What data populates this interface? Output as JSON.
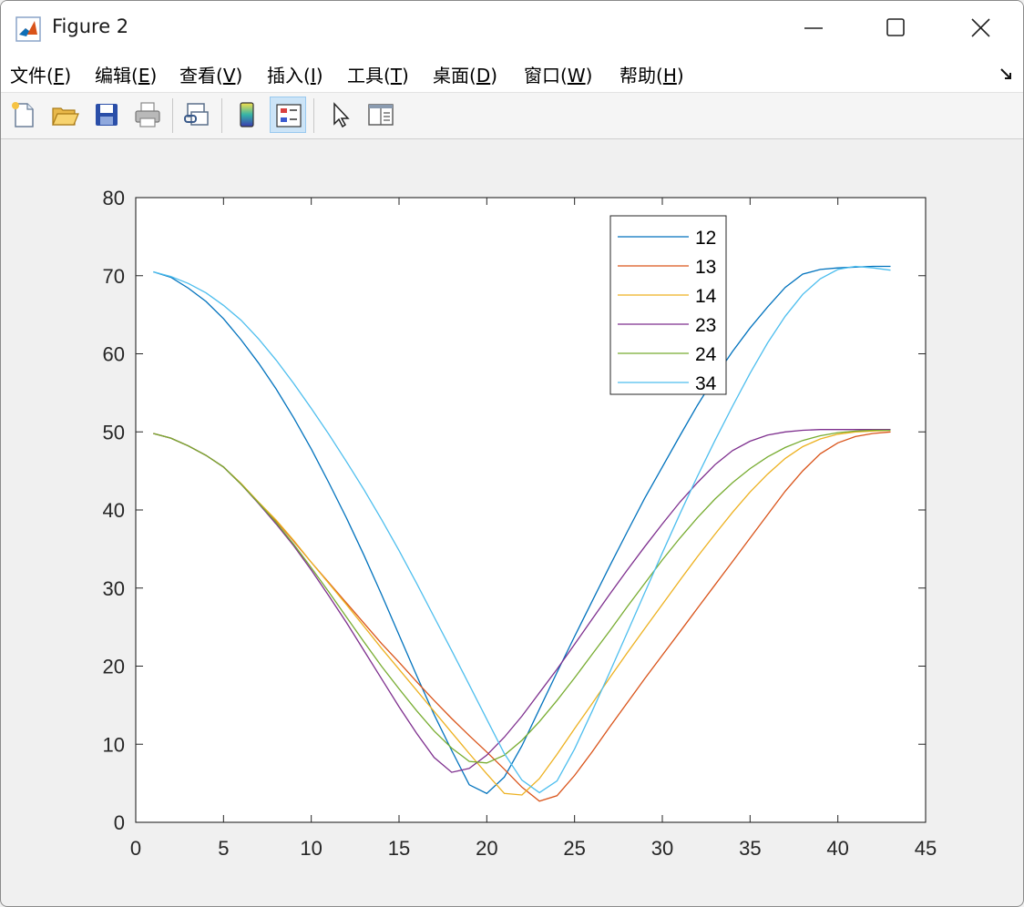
{
  "window": {
    "title": "Figure 2",
    "app_icon": "matlab-icon"
  },
  "menu": [
    {
      "label": "文件(",
      "key": "F",
      "end": ")"
    },
    {
      "label": "编辑(",
      "key": "E",
      "end": ")"
    },
    {
      "label": "查看(",
      "key": "V",
      "end": ")"
    },
    {
      "label": "插入(",
      "key": "I",
      "end": ")"
    },
    {
      "label": "工具(",
      "key": "T",
      "end": ")"
    },
    {
      "label": "桌面(",
      "key": "D",
      "end": ")"
    },
    {
      "label": "窗口(",
      "key": "W",
      "end": ")"
    },
    {
      "label": "帮助(",
      "key": "H",
      "end": ")"
    }
  ],
  "toolbar": [
    {
      "icon": "new-figure-icon"
    },
    {
      "icon": "open-file-icon"
    },
    {
      "icon": "save-icon"
    },
    {
      "icon": "print-icon"
    },
    {
      "icon": "link-plot-icon"
    },
    {
      "icon": "colorbar-icon"
    },
    {
      "icon": "legend-icon",
      "active": true
    },
    {
      "icon": "pointer-icon"
    },
    {
      "icon": "property-inspector-icon"
    }
  ],
  "chart_data": {
    "type": "line",
    "xlim": [
      0,
      45
    ],
    "ylim": [
      0,
      80
    ],
    "xticks": [
      0,
      5,
      10,
      15,
      20,
      25,
      30,
      35,
      40,
      45
    ],
    "yticks": [
      0,
      10,
      20,
      30,
      40,
      50,
      60,
      70,
      80
    ],
    "legend_position": "top-right",
    "grid": false,
    "series": [
      {
        "name": "12",
        "color": "#0072BD",
        "x": [
          1,
          2,
          3,
          4,
          5,
          6,
          7,
          8,
          9,
          10,
          11,
          12,
          13,
          14,
          15,
          16,
          17,
          18,
          19,
          20,
          21,
          22,
          23,
          24,
          25,
          26,
          27,
          28,
          29,
          30,
          31,
          32,
          33,
          34,
          35,
          36,
          37,
          38,
          39,
          40,
          41,
          42,
          43
        ],
        "y": [
          70.5,
          69.8,
          68.4,
          66.7,
          64.5,
          61.8,
          58.8,
          55.5,
          51.8,
          47.8,
          43.5,
          39.0,
          34.2,
          29.2,
          24.0,
          18.8,
          13.8,
          9.2,
          4.8,
          3.7,
          5.8,
          9.8,
          14.5,
          19.2,
          23.8,
          28.3,
          32.8,
          37.2,
          41.5,
          45.5,
          49.5,
          53.4,
          57.0,
          60.3,
          63.3,
          66.0,
          68.5,
          70.2,
          70.8,
          71.0,
          71.1,
          71.2,
          71.2
        ]
      },
      {
        "name": "13",
        "color": "#D95319",
        "x": [
          1,
          2,
          3,
          4,
          5,
          6,
          7,
          8,
          9,
          10,
          11,
          12,
          13,
          14,
          15,
          16,
          17,
          18,
          19,
          20,
          21,
          22,
          23,
          24,
          25,
          26,
          27,
          28,
          29,
          30,
          31,
          32,
          33,
          34,
          35,
          36,
          37,
          38,
          39,
          40,
          41,
          42,
          43
        ],
        "y": [
          49.8,
          49.2,
          48.2,
          47.0,
          45.5,
          43.3,
          40.9,
          38.6,
          36.0,
          33.3,
          30.7,
          28.1,
          25.5,
          22.9,
          20.5,
          18.0,
          15.6,
          13.3,
          11.1,
          9.0,
          6.8,
          4.5,
          2.7,
          3.4,
          6.0,
          9.0,
          12.2,
          15.3,
          18.4,
          21.4,
          24.4,
          27.4,
          30.4,
          33.4,
          36.4,
          39.4,
          42.4,
          45.0,
          47.2,
          48.6,
          49.4,
          49.8,
          50.0
        ]
      },
      {
        "name": "14",
        "color": "#EDB120",
        "x": [
          1,
          2,
          3,
          4,
          5,
          6,
          7,
          8,
          9,
          10,
          11,
          12,
          13,
          14,
          15,
          16,
          17,
          18,
          19,
          20,
          21,
          22,
          23,
          24,
          25,
          26,
          27,
          28,
          29,
          30,
          31,
          32,
          33,
          34,
          35,
          36,
          37,
          38,
          39,
          40,
          41,
          42,
          43
        ],
        "y": [
          49.8,
          49.2,
          48.2,
          47.0,
          45.5,
          43.4,
          41.0,
          38.7,
          36.1,
          33.3,
          30.6,
          27.9,
          25.1,
          22.3,
          19.6,
          16.9,
          14.2,
          11.5,
          8.8,
          6.2,
          3.7,
          3.5,
          5.6,
          8.7,
          12.0,
          15.2,
          18.5,
          21.7,
          24.8,
          27.9,
          31.0,
          34.0,
          36.9,
          39.7,
          42.3,
          44.6,
          46.6,
          48.1,
          49.1,
          49.7,
          50.0,
          50.1,
          50.2
        ]
      },
      {
        "name": "23",
        "color": "#7E2F8E",
        "x": [
          1,
          2,
          3,
          4,
          5,
          6,
          7,
          8,
          9,
          10,
          11,
          12,
          13,
          14,
          15,
          16,
          17,
          18,
          19,
          20,
          21,
          22,
          23,
          24,
          25,
          26,
          27,
          28,
          29,
          30,
          31,
          32,
          33,
          34,
          35,
          36,
          37,
          38,
          39,
          40,
          41,
          42,
          43
        ],
        "y": [
          49.8,
          49.2,
          48.2,
          47.0,
          45.5,
          43.3,
          40.8,
          38.2,
          35.4,
          32.3,
          29.0,
          25.6,
          22.0,
          18.4,
          14.8,
          11.4,
          8.3,
          6.4,
          6.9,
          8.6,
          10.9,
          13.6,
          16.6,
          19.6,
          22.8,
          26.0,
          29.2,
          32.3,
          35.3,
          38.2,
          41.0,
          43.5,
          45.8,
          47.6,
          48.8,
          49.6,
          50.0,
          50.2,
          50.3,
          50.3,
          50.3,
          50.3,
          50.3
        ]
      },
      {
        "name": "24",
        "color": "#77AC30",
        "x": [
          1,
          2,
          3,
          4,
          5,
          6,
          7,
          8,
          9,
          10,
          11,
          12,
          13,
          14,
          15,
          16,
          17,
          18,
          19,
          20,
          21,
          22,
          23,
          24,
          25,
          26,
          27,
          28,
          29,
          30,
          31,
          32,
          33,
          34,
          35,
          36,
          37,
          38,
          39,
          40,
          41,
          42,
          43
        ],
        "y": [
          49.8,
          49.2,
          48.2,
          47.0,
          45.5,
          43.3,
          40.9,
          38.4,
          35.6,
          32.6,
          29.5,
          26.3,
          23.1,
          20.0,
          17.1,
          14.3,
          11.7,
          9.5,
          7.8,
          7.6,
          8.6,
          10.5,
          12.9,
          15.6,
          18.5,
          21.5,
          24.5,
          27.6,
          30.6,
          33.6,
          36.4,
          39.0,
          41.4,
          43.5,
          45.3,
          46.8,
          48.0,
          48.9,
          49.5,
          49.9,
          50.1,
          50.2,
          50.2
        ]
      },
      {
        "name": "34",
        "color": "#4DBEEE",
        "x": [
          1,
          2,
          3,
          4,
          5,
          6,
          7,
          8,
          9,
          10,
          11,
          12,
          13,
          14,
          15,
          16,
          17,
          18,
          19,
          20,
          21,
          22,
          23,
          24,
          25,
          26,
          27,
          28,
          29,
          30,
          31,
          32,
          33,
          34,
          35,
          36,
          37,
          38,
          39,
          40,
          41,
          42,
          43
        ],
        "y": [
          70.5,
          69.9,
          69.0,
          67.8,
          66.2,
          64.3,
          61.9,
          59.2,
          56.2,
          53.0,
          49.7,
          46.2,
          42.6,
          38.8,
          34.8,
          30.6,
          26.3,
          22.0,
          17.6,
          13.2,
          8.8,
          5.4,
          3.8,
          5.3,
          9.4,
          14.2,
          19.2,
          24.3,
          29.4,
          34.5,
          39.5,
          44.3,
          48.9,
          53.3,
          57.5,
          61.4,
          64.8,
          67.6,
          69.6,
          70.8,
          71.2,
          71.0,
          70.7
        ]
      }
    ]
  }
}
